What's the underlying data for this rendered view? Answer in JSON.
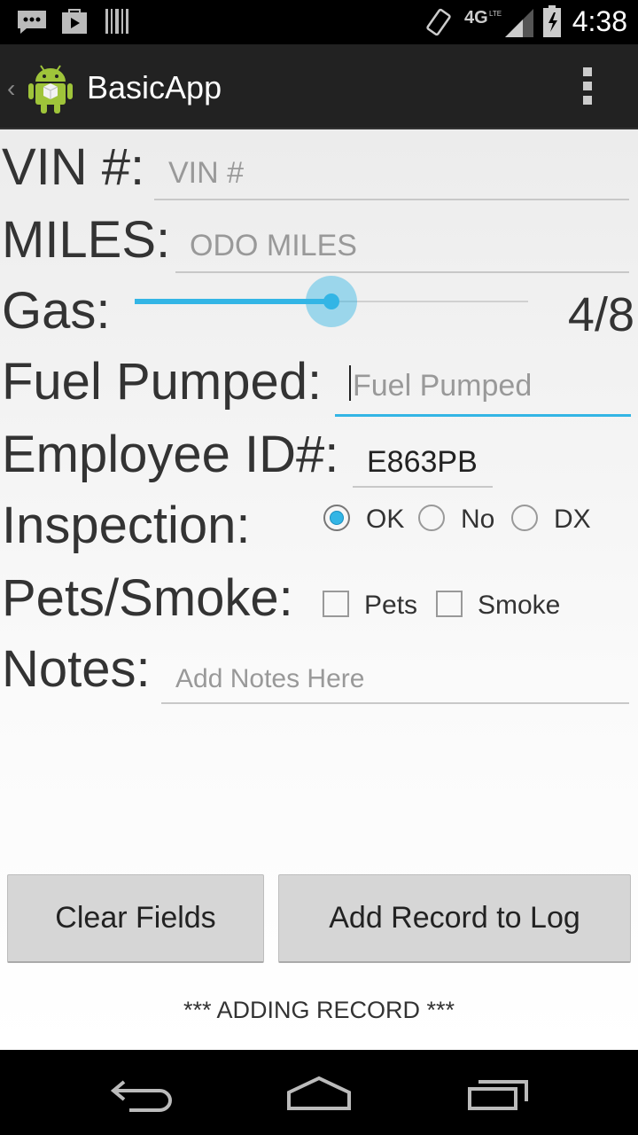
{
  "status_bar": {
    "time": "4:38",
    "icons": [
      "message-icon",
      "play-store-icon",
      "barcode-icon",
      "rotation-icon",
      "4g-lte-icon",
      "signal-icon",
      "battery-icon"
    ]
  },
  "action_bar": {
    "title": "BasicApp",
    "icon": "android-robot-icon"
  },
  "form": {
    "vin": {
      "label": "VIN #:",
      "placeholder": "VIN #",
      "value": ""
    },
    "miles": {
      "label": "MILES:",
      "placeholder": "ODO MILES",
      "value": ""
    },
    "gas": {
      "label": "Gas:",
      "value_text": "4/8",
      "fraction": 0.5
    },
    "fuel": {
      "label": "Fuel Pumped:",
      "placeholder": "Fuel Pumped",
      "value": ""
    },
    "employee": {
      "label": "Employee ID#:",
      "value": "E863PB"
    },
    "inspection": {
      "label": "Inspection:",
      "options": [
        "OK",
        "No",
        "DX"
      ],
      "selected": "OK"
    },
    "pets_smoke": {
      "label": "Pets/Smoke:",
      "options": [
        "Pets",
        "Smoke"
      ],
      "checked": []
    },
    "notes": {
      "label": "Notes:",
      "placeholder": "Add Notes Here",
      "value": ""
    }
  },
  "buttons": {
    "clear": "Clear Fields",
    "add": "Add Record to Log"
  },
  "status_message": "*** ADDING RECORD ***",
  "nav": [
    "back-icon",
    "home-icon",
    "recents-icon"
  ],
  "colors": {
    "accent": "#33b5e5",
    "action_bar": "#222222"
  }
}
